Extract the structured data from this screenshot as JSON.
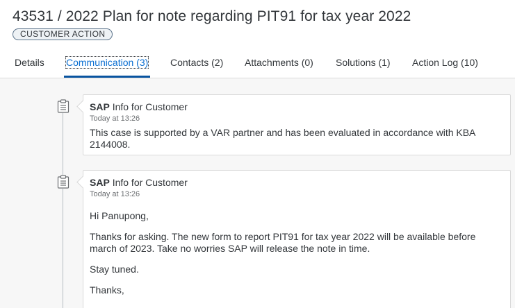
{
  "header": {
    "title": "43531 / 2022 Plan for note regarding PIT91 for tax year 2022",
    "status": "CUSTOMER ACTION"
  },
  "tabs": [
    {
      "label": "Details"
    },
    {
      "label": "Communication (3)",
      "active": true
    },
    {
      "label": "Contacts (2)"
    },
    {
      "label": "Attachments (0)"
    },
    {
      "label": "Solutions (1)"
    },
    {
      "label": "Action Log (10)"
    }
  ],
  "messages": [
    {
      "icon": "clipboard-icon",
      "author": "SAP",
      "type": "Info for Customer",
      "time": "Today at 13:26",
      "paragraphs": [
        "This case is supported by a VAR partner and has been evaluated in accordance with KBA 2144008."
      ]
    },
    {
      "icon": "clipboard-icon",
      "author": "SAP",
      "type": "Info for Customer",
      "time": "Today at 13:26",
      "paragraphs": [
        "Hi Panupong,",
        "Thanks for asking. The new form to report PIT91 for tax year 2022 will be available before march of 2023. Take no worries SAP will release the note in time.",
        "Stay tuned.",
        "Thanks,"
      ]
    }
  ],
  "colors": {
    "accent": "#0a6ed1",
    "tab_underline": "#0854a0",
    "text": "#32363a",
    "badge_border": "#5b738b"
  }
}
